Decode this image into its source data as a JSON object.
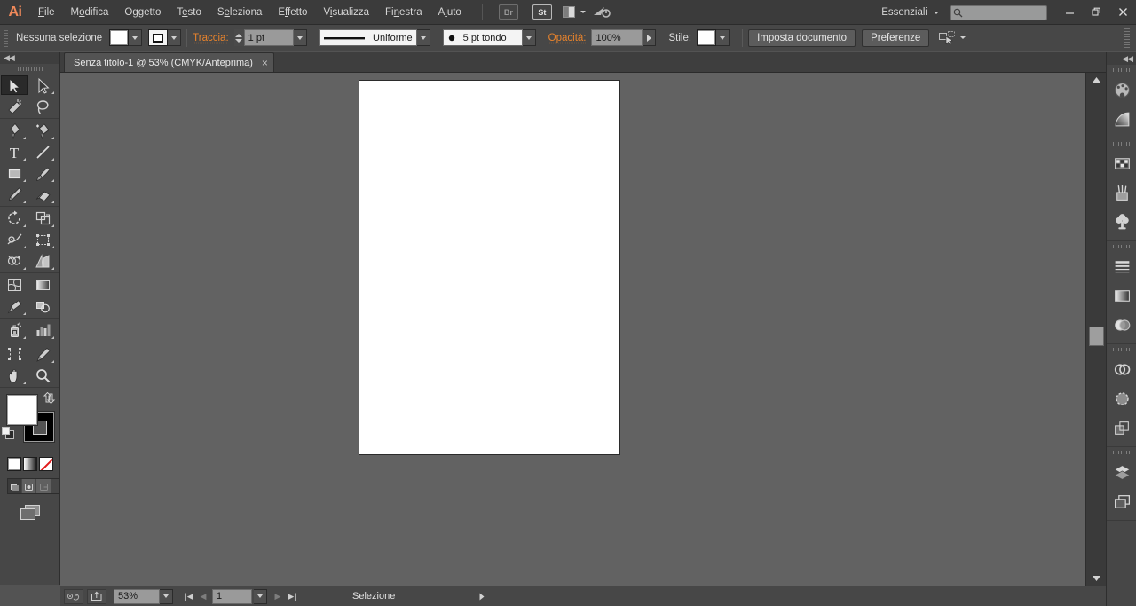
{
  "app": {
    "name": "Adobe Illustrator",
    "logo_text": "Ai"
  },
  "menubar": {
    "items": [
      {
        "label": "File",
        "mnemonic_index": 0
      },
      {
        "label": "Modifica",
        "mnemonic_index": 1
      },
      {
        "label": "Oggetto",
        "mnemonic_index": 1
      },
      {
        "label": "Testo",
        "mnemonic_index": 1
      },
      {
        "label": "Seleziona",
        "mnemonic_index": 1
      },
      {
        "label": "Effetto",
        "mnemonic_index": 1
      },
      {
        "label": "Visualizza",
        "mnemonic_index": 1
      },
      {
        "label": "Finestra",
        "mnemonic_index": 2
      },
      {
        "label": "Aiuto",
        "mnemonic_index": 1
      }
    ],
    "bridge_badge": "Br",
    "stock_badge": "St",
    "arrange_icon": "arrange-documents-icon",
    "cc_icon": "creative-cloud-icon",
    "workspace": "Essenziali",
    "search_placeholder": "",
    "search_value": "",
    "window_buttons": {
      "minimize": "—",
      "restore": "❐",
      "close": "✕"
    }
  },
  "controlbar": {
    "selection_status": "Nessuna selezione",
    "fill_swatch": "#ffffff",
    "stroke_swatch": "#000000",
    "stroke_label": "Traccia:",
    "stroke_weight": "1 pt",
    "stroke_profile": "Uniforme",
    "brush_definition": "5 pt tondo",
    "opacity_label": "Opacità:",
    "opacity_value": "100%",
    "style_label": "Stile:",
    "style_swatch": "#ffffff",
    "document_setup_label": "Imposta documento",
    "preferences_label": "Preferenze",
    "select_similar_icon": "select-similar-objects-icon"
  },
  "tabbar": {
    "document_tab": "Senza titolo-1 @ 53% (CMYK/Anteprima)",
    "close_glyph": "×"
  },
  "tools": {
    "collapse_glyph": "◀◀",
    "groups": [
      {
        "rows": [
          [
            {
              "name": "selection-tool",
              "active": true,
              "has_flyout": false
            },
            {
              "name": "direct-selection-tool",
              "active": false,
              "has_flyout": true
            }
          ],
          [
            {
              "name": "magic-wand-tool",
              "active": false,
              "has_flyout": false
            },
            {
              "name": "lasso-tool",
              "active": false,
              "has_flyout": false
            }
          ]
        ]
      },
      {
        "rows": [
          [
            {
              "name": "pen-tool",
              "active": false,
              "has_flyout": true
            },
            {
              "name": "add-anchor-point-tool",
              "active": false,
              "has_flyout": true
            }
          ],
          [
            {
              "name": "type-tool",
              "active": false,
              "has_flyout": true
            },
            {
              "name": "line-segment-tool",
              "active": false,
              "has_flyout": true
            }
          ],
          [
            {
              "name": "rectangle-tool",
              "active": false,
              "has_flyout": true
            },
            {
              "name": "paintbrush-tool",
              "active": false,
              "has_flyout": true
            }
          ],
          [
            {
              "name": "pencil-tool",
              "active": false,
              "has_flyout": true
            },
            {
              "name": "eraser-tool",
              "active": false,
              "has_flyout": true
            }
          ]
        ]
      },
      {
        "rows": [
          [
            {
              "name": "rotate-tool",
              "active": false,
              "has_flyout": true
            },
            {
              "name": "scale-tool",
              "active": false,
              "has_flyout": true
            }
          ],
          [
            {
              "name": "width-tool",
              "active": false,
              "has_flyout": true
            },
            {
              "name": "free-transform-tool",
              "active": false,
              "has_flyout": true
            }
          ],
          [
            {
              "name": "shape-builder-tool",
              "active": false,
              "has_flyout": true
            },
            {
              "name": "perspective-grid-tool",
              "active": false,
              "has_flyout": true
            }
          ]
        ]
      },
      {
        "rows": [
          [
            {
              "name": "mesh-tool",
              "active": false,
              "has_flyout": false
            },
            {
              "name": "gradient-tool",
              "active": false,
              "has_flyout": false
            }
          ],
          [
            {
              "name": "eyedropper-tool",
              "active": false,
              "has_flyout": true
            },
            {
              "name": "blend-tool",
              "active": false,
              "has_flyout": false
            }
          ]
        ]
      },
      {
        "rows": [
          [
            {
              "name": "symbol-sprayer-tool",
              "active": false,
              "has_flyout": true
            },
            {
              "name": "column-graph-tool",
              "active": false,
              "has_flyout": true
            }
          ]
        ]
      },
      {
        "rows": [
          [
            {
              "name": "artboard-tool",
              "active": false,
              "has_flyout": false
            },
            {
              "name": "slice-tool",
              "active": false,
              "has_flyout": true
            }
          ],
          [
            {
              "name": "hand-tool",
              "active": false,
              "has_flyout": true
            },
            {
              "name": "zoom-tool",
              "active": false,
              "has_flyout": false
            }
          ]
        ]
      }
    ],
    "fill_color": "#ffffff",
    "stroke_color": "#000000",
    "swap_icon": "swap-fill-stroke-icon",
    "default_icon": "default-fill-stroke-icon",
    "color_modes": [
      {
        "name": "color-mode-button",
        "value": "#ffffff"
      },
      {
        "name": "gradient-mode-button",
        "value": "gradient"
      },
      {
        "name": "none-mode-button",
        "value": "none"
      }
    ],
    "screen_modes": [
      {
        "name": "screen-mode-normal",
        "selected": true
      },
      {
        "name": "screen-mode-full-menu",
        "selected": false
      },
      {
        "name": "screen-mode-full",
        "selected": false
      }
    ],
    "change_screen_mode_icon": "change-screen-mode-icon"
  },
  "canvas": {
    "background_color": "#626262",
    "artboard_color": "#ffffff",
    "artboard_border": "#2b2b2b"
  },
  "statusbar": {
    "preflight_icon": "preflight-icon",
    "share_icon": "share-on-behance-icon",
    "zoom_level": "53%",
    "page_number": "1",
    "status_text": "Selezione",
    "first_glyph": "|◀",
    "prev_glyph": "◀",
    "next_glyph": "▶",
    "last_glyph": "▶|"
  },
  "rightdock": {
    "collapse_glyph": "◀◀",
    "groups": [
      {
        "icons": [
          "color-panel-icon",
          "color-guide-panel-icon"
        ]
      },
      {
        "icons": [
          "swatches-panel-icon",
          "brushes-panel-icon",
          "symbols-panel-icon"
        ]
      },
      {
        "icons": [
          "stroke-panel-icon",
          "gradient-panel-icon",
          "transparency-panel-icon"
        ]
      },
      {
        "icons": [
          "pathfinder-panel-icon",
          "align-panel-icon",
          "transform-panel-icon"
        ]
      },
      {
        "icons": [
          "layers-panel-icon",
          "artboards-panel-icon"
        ]
      }
    ]
  }
}
